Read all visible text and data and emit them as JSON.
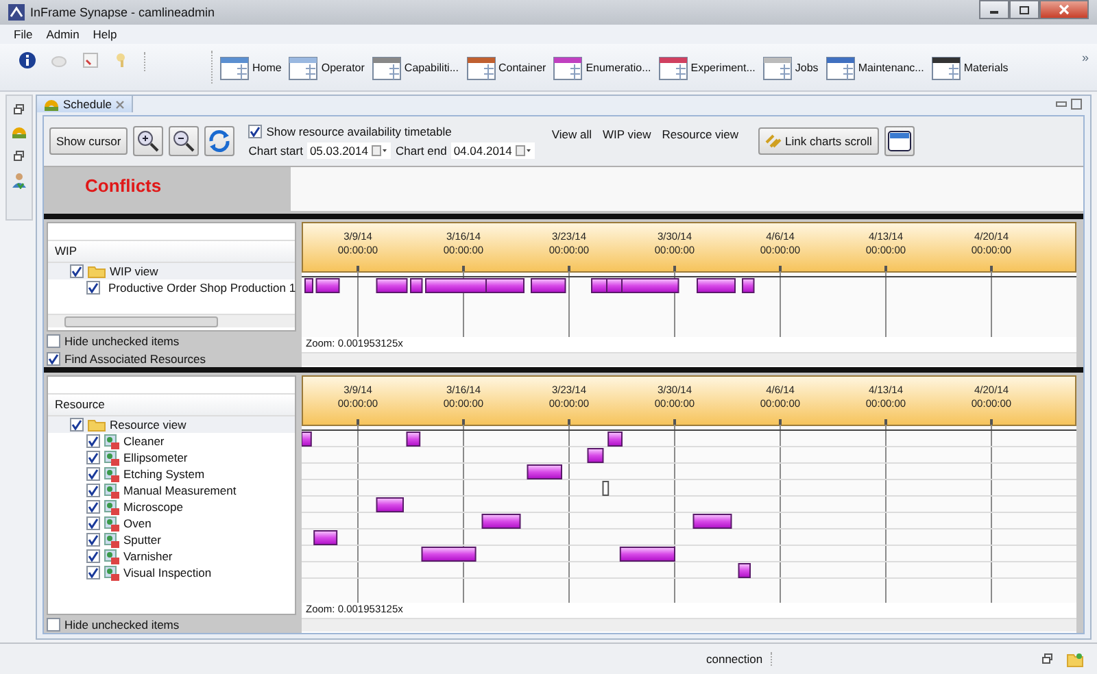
{
  "window": {
    "title": "InFrame Synapse - camlineadmin"
  },
  "menu": [
    "File",
    "Admin",
    "Help"
  ],
  "nav": [
    "Home",
    "Operator",
    "Capabiliti...",
    "Container",
    "Enumeratio...",
    "Experiment...",
    "Jobs",
    "Maintenanc...",
    "Materials"
  ],
  "overflow": "»",
  "tab": {
    "label": "Schedule",
    "selected": true
  },
  "controls": {
    "show_cursor": "Show cursor",
    "availability": {
      "label": "Show resource availability timetable",
      "checked": true
    },
    "chart_start": {
      "label": "Chart start",
      "value": "05.03.2014"
    },
    "chart_end": {
      "label": "Chart end",
      "value": "04.04.2014"
    },
    "views": [
      "View all",
      "WIP view",
      "Resource view"
    ],
    "link_scroll": "Link charts scroll"
  },
  "conflicts": {
    "title": "Conflicts"
  },
  "panels": [
    {
      "header": "WIP",
      "tree": [
        {
          "label": "WIP view",
          "checked": true,
          "selected": true,
          "children": [
            {
              "label": "Productive Order Shop Production 1",
              "checked": true,
              "selected": false
            }
          ]
        }
      ],
      "options": [
        {
          "label": "Hide unchecked items",
          "checked": false
        },
        {
          "label": "Find Associated Resources",
          "checked": true
        }
      ],
      "ticks": [
        {
          "date": "3/9/14",
          "time": "00:00:00"
        },
        {
          "date": "3/16/14",
          "time": "00:00:00"
        },
        {
          "date": "3/23/14",
          "time": "00:00:00"
        },
        {
          "date": "3/30/14",
          "time": "00:00:00"
        },
        {
          "date": "4/6/14",
          "time": "00:00:00"
        },
        {
          "date": "4/13/14",
          "time": "00:00:00"
        },
        {
          "date": "4/20/14",
          "time": "00:00:00"
        }
      ],
      "zoom": "Zoom:  0.001953125x"
    },
    {
      "header": "Resource",
      "tree": [
        {
          "label": "Resource view",
          "checked": true,
          "selected": true,
          "children": [
            {
              "label": "Cleaner",
              "checked": true,
              "selected": false
            },
            {
              "label": "Ellipsometer",
              "checked": true,
              "selected": false
            },
            {
              "label": "Etching System",
              "checked": true,
              "selected": false
            },
            {
              "label": "Manual Measurement",
              "checked": true,
              "selected": false
            },
            {
              "label": "Microscope",
              "checked": true,
              "selected": false
            },
            {
              "label": "Oven",
              "checked": true,
              "selected": false
            },
            {
              "label": "Sputter",
              "checked": true,
              "selected": false
            },
            {
              "label": "Varnisher",
              "checked": true,
              "selected": false
            },
            {
              "label": "Visual Inspection",
              "checked": true,
              "selected": false
            }
          ]
        }
      ],
      "options": [
        {
          "label": "Hide unchecked items",
          "checked": false
        }
      ],
      "ticks": [
        {
          "date": "3/9/14",
          "time": "00:00:00"
        },
        {
          "date": "3/16/14",
          "time": "00:00:00"
        },
        {
          "date": "3/23/14",
          "time": "00:00:00"
        },
        {
          "date": "3/30/14",
          "time": "00:00:00"
        },
        {
          "date": "4/6/14",
          "time": "00:00:00"
        },
        {
          "date": "4/13/14",
          "time": "00:00:00"
        },
        {
          "date": "4/20/14",
          "time": "00:00:00"
        }
      ],
      "zoom": "Zoom:  0.001953125x"
    }
  ],
  "status_bar": {
    "text": "connection"
  }
}
